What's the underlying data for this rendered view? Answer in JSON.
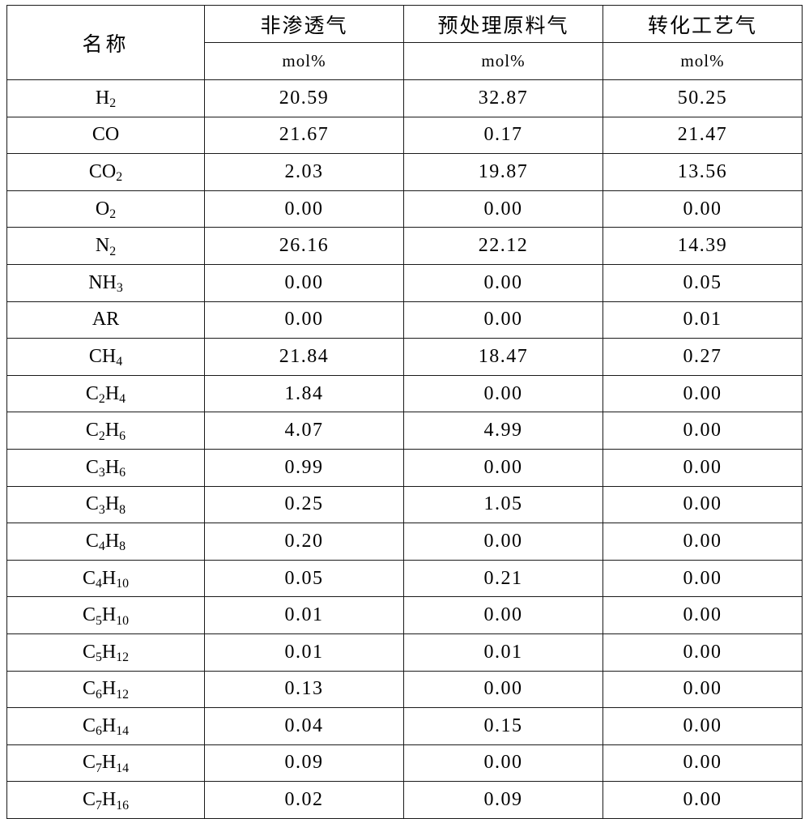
{
  "table": {
    "name_header": "名称",
    "columns": [
      {
        "title": "非渗透气",
        "unit": "mol%"
      },
      {
        "title": "预处理原料气",
        "unit": "mol%"
      },
      {
        "title": "转化工艺气",
        "unit": "mol%"
      }
    ],
    "rows": [
      {
        "species": "H2",
        "species_base": "H",
        "species_sub": "2",
        "values": [
          "20.59",
          "32.87",
          "50.25"
        ]
      },
      {
        "species": "CO",
        "species_base": "CO",
        "species_sub": "",
        "values": [
          "21.67",
          "0.17",
          "21.47"
        ]
      },
      {
        "species": "CO2",
        "species_base": "CO",
        "species_sub": "2",
        "values": [
          "2.03",
          "19.87",
          "13.56"
        ]
      },
      {
        "species": "O2",
        "species_base": "O",
        "species_sub": "2",
        "values": [
          "0.00",
          "0.00",
          "0.00"
        ]
      },
      {
        "species": "N2",
        "species_base": "N",
        "species_sub": "2",
        "values": [
          "26.16",
          "22.12",
          "14.39"
        ]
      },
      {
        "species": "NH3",
        "species_base": "NH",
        "species_sub": "3",
        "values": [
          "0.00",
          "0.00",
          "0.05"
        ]
      },
      {
        "species": "AR",
        "species_base": "AR",
        "species_sub": "",
        "values": [
          "0.00",
          "0.00",
          "0.01"
        ]
      },
      {
        "species": "CH4",
        "species_base": "CH",
        "species_sub": "4",
        "values": [
          "21.84",
          "18.47",
          "0.27"
        ]
      },
      {
        "species": "C2H4",
        "species_base": "C",
        "species_sub": "2",
        "values": [
          "1.84",
          "0.00",
          "0.00"
        ]
      },
      {
        "species": "C2H6",
        "species_base": "C",
        "species_sub": "2",
        "values": [
          "4.07",
          "4.99",
          "0.00"
        ]
      },
      {
        "species": "C3H6",
        "species_base": "C",
        "species_sub": "3",
        "values": [
          "0.99",
          "0.00",
          "0.00"
        ]
      },
      {
        "species": "C3H8",
        "species_base": "C",
        "species_sub": "3",
        "values": [
          "0.25",
          "1.05",
          "0.00"
        ]
      },
      {
        "species": "C4H8",
        "species_base": "C",
        "species_sub": "4",
        "values": [
          "0.20",
          "0.00",
          "0.00"
        ]
      },
      {
        "species": "C4H10",
        "species_base": "C",
        "species_sub": "4",
        "values": [
          "0.05",
          "0.21",
          "0.00"
        ]
      },
      {
        "species": "C5H10",
        "species_base": "C",
        "species_sub": "5",
        "values": [
          "0.01",
          "0.00",
          "0.00"
        ]
      },
      {
        "species": "C5H12",
        "species_base": "C",
        "species_sub": "5",
        "values": [
          "0.01",
          "0.01",
          "0.00"
        ]
      },
      {
        "species": "C6H12",
        "species_base": "C",
        "species_sub": "6",
        "values": [
          "0.13",
          "0.00",
          "0.00"
        ]
      },
      {
        "species": "C6H14",
        "species_base": "C",
        "species_sub": "6",
        "values": [
          "0.04",
          "0.15",
          "0.00"
        ]
      },
      {
        "species": "C7H14",
        "species_base": "C",
        "species_sub": "7",
        "values": [
          "0.09",
          "0.00",
          "0.00"
        ]
      },
      {
        "species": "C7H16",
        "species_base": "C",
        "species_sub": "7",
        "values": [
          "0.02",
          "0.09",
          "0.00"
        ]
      }
    ]
  },
  "chart_data": {
    "type": "table",
    "title": "",
    "columns": [
      "名称",
      "非渗透气 mol%",
      "预处理原料气 mol%",
      "转化工艺气 mol%"
    ],
    "categories": [
      "H2",
      "CO",
      "CO2",
      "O2",
      "N2",
      "NH3",
      "AR",
      "CH4",
      "C2H4",
      "C2H6",
      "C3H6",
      "C3H8",
      "C4H8",
      "C4H10",
      "C5H10",
      "C5H12",
      "C6H12",
      "C6H14",
      "C7H14",
      "C7H16"
    ],
    "series": [
      {
        "name": "非渗透气",
        "unit": "mol%",
        "values": [
          20.59,
          21.67,
          2.03,
          0.0,
          26.16,
          0.0,
          0.0,
          21.84,
          1.84,
          4.07,
          0.99,
          0.25,
          0.2,
          0.05,
          0.01,
          0.01,
          0.13,
          0.04,
          0.09,
          0.02
        ]
      },
      {
        "name": "预处理原料气",
        "unit": "mol%",
        "values": [
          32.87,
          0.17,
          19.87,
          0.0,
          22.12,
          0.0,
          0.0,
          18.47,
          0.0,
          4.99,
          0.0,
          1.05,
          0.0,
          0.21,
          0.0,
          0.01,
          0.0,
          0.15,
          0.0,
          0.09
        ]
      },
      {
        "name": "转化工艺气",
        "unit": "mol%",
        "values": [
          50.25,
          21.47,
          13.56,
          0.0,
          14.39,
          0.05,
          0.01,
          0.27,
          0.0,
          0.0,
          0.0,
          0.0,
          0.0,
          0.0,
          0.0,
          0.0,
          0.0,
          0.0,
          0.0,
          0.0
        ]
      }
    ]
  }
}
